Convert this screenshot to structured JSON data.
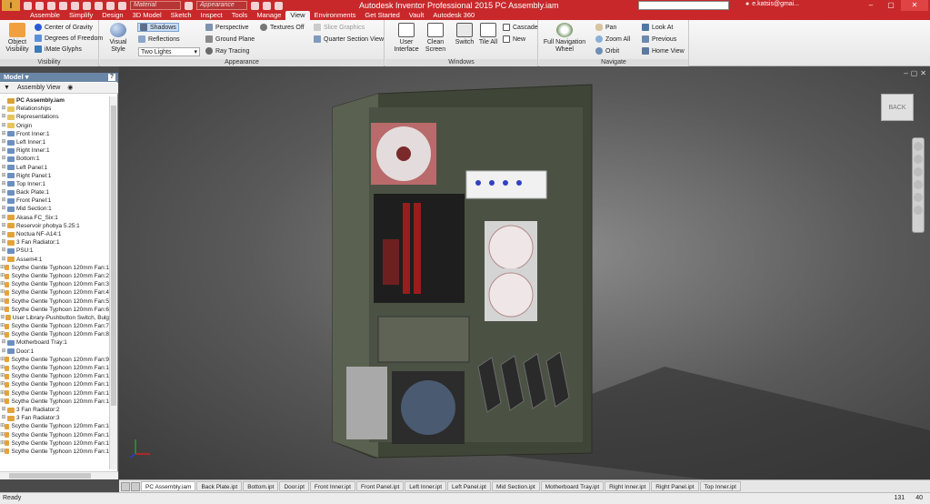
{
  "window": {
    "title": "Autodesk Inventor Professional 2015   PC Assembly.iam",
    "logo": "I",
    "material_combo": "Material",
    "appearance_combo": "Appearance",
    "user": "e.katsis@gmai...",
    "min": "–",
    "max": "▢",
    "close": "✕"
  },
  "ribbon_tabs": [
    "Assemble",
    "Simplify",
    "Design",
    "3D Model",
    "Sketch",
    "Inspect",
    "Tools",
    "Manage",
    "View",
    "Environments",
    "Get Started",
    "Vault",
    "Autodesk 360"
  ],
  "active_tab": "View",
  "ribbon": {
    "visibility": {
      "label": "Visibility",
      "object_visibility": "Object Visibility",
      "center_of_gravity": "Center of Gravity",
      "degrees_of_freedom": "Degrees of Freedom",
      "imate_glyphs": "iMate Glyphs"
    },
    "appearance": {
      "label": "Appearance",
      "visual_style": "Visual Style",
      "shadows": "Shadows",
      "reflections": "Reflections",
      "lighting": "Two Lights",
      "perspective": "Perspective",
      "ground_plane": "Ground Plane",
      "ray_tracing": "Ray Tracing",
      "textures": "Textures Off",
      "slice_graphics": "Slice Graphics",
      "quarter_section": "Quarter Section View"
    },
    "windows": {
      "label": "Windows",
      "user_interface": "User Interface",
      "clean_screen": "Clean Screen",
      "switch": "Switch",
      "tile_all": "Tile All",
      "cascade": "Cascade",
      "new": "New"
    },
    "navigate": {
      "label": "Navigate",
      "full_nav_wheel": "Full Navigation Wheel",
      "pan": "Pan",
      "zoom_all": "Zoom All",
      "orbit": "Orbit",
      "look_at": "Look At",
      "previous": "Previous",
      "home_view": "Home View"
    }
  },
  "browser": {
    "header": "Model ▾",
    "help": "?",
    "toolbar_view": "Assembly View",
    "items": [
      {
        "label": "PC Assembly.iam",
        "icon": "assembly-icon",
        "root": true
      },
      {
        "label": "Relationships",
        "icon": "folder-icon"
      },
      {
        "label": "Representations",
        "icon": "folder-icon"
      },
      {
        "label": "Origin",
        "icon": "folder-icon"
      },
      {
        "label": "Front Inner:1",
        "icon": "part-icon"
      },
      {
        "label": "Left Inner:1",
        "icon": "part-icon"
      },
      {
        "label": "Right Inner:1",
        "icon": "part-icon"
      },
      {
        "label": "Bottom:1",
        "icon": "part-icon"
      },
      {
        "label": "Left Panel:1",
        "icon": "part-icon"
      },
      {
        "label": "Right Panel:1",
        "icon": "part-icon"
      },
      {
        "label": "Top Inner:1",
        "icon": "part-icon"
      },
      {
        "label": "Back Plate:1",
        "icon": "part-icon"
      },
      {
        "label": "Front Panel:1",
        "icon": "part-icon"
      },
      {
        "label": "Mid Section:1",
        "icon": "part-icon"
      },
      {
        "label": "Akasa FC_Six:1",
        "icon": "subassembly-icon"
      },
      {
        "label": "Reservoir phobya 5.25:1",
        "icon": "subassembly-icon"
      },
      {
        "label": "Noctua NF-A14:1",
        "icon": "subassembly-icon"
      },
      {
        "label": "3 Fan Radiator:1",
        "icon": "subassembly-icon"
      },
      {
        "label": "PSU:1",
        "icon": "part-icon"
      },
      {
        "label": "Assem4:1",
        "icon": "subassembly-icon"
      },
      {
        "label": "Scythe Gentle Typhoon 120mm Fan:1",
        "icon": "subassembly-icon"
      },
      {
        "label": "Scythe Gentle Typhoon 120mm Fan:2",
        "icon": "subassembly-icon"
      },
      {
        "label": "Scythe Gentle Typhoon 120mm Fan:3",
        "icon": "subassembly-icon"
      },
      {
        "label": "Scythe Gentle Typhoon 120mm Fan:4",
        "icon": "subassembly-icon"
      },
      {
        "label": "Scythe Gentle Typhoon 120mm Fan:5",
        "icon": "subassembly-icon"
      },
      {
        "label": "Scythe Gentle Typhoon 120mm Fan:6",
        "icon": "subassembly-icon"
      },
      {
        "label": "User Library-Pushbutton Switch, Bulg",
        "icon": "subassembly-icon"
      },
      {
        "label": "Scythe Gentle Typhoon 120mm Fan:7",
        "icon": "subassembly-icon"
      },
      {
        "label": "Scythe Gentle Typhoon 120mm Fan:8",
        "icon": "subassembly-icon"
      },
      {
        "label": "Motherboard Tray:1",
        "icon": "part-icon"
      },
      {
        "label": "Door:1",
        "icon": "part-icon"
      },
      {
        "label": "Scythe Gentle Typhoon 120mm Fan:9",
        "icon": "subassembly-icon"
      },
      {
        "label": "Scythe Gentle Typhoon 120mm Fan:1",
        "icon": "subassembly-icon"
      },
      {
        "label": "Scythe Gentle Typhoon 120mm Fan:1",
        "icon": "subassembly-icon"
      },
      {
        "label": "Scythe Gentle Typhoon 120mm Fan:1",
        "icon": "subassembly-icon"
      },
      {
        "label": "Scythe Gentle Typhoon 120mm Fan:1",
        "icon": "subassembly-icon"
      },
      {
        "label": "Scythe Gentle Typhoon 120mm Fan:1",
        "icon": "subassembly-icon"
      },
      {
        "label": "3 Fan Radiator:2",
        "icon": "subassembly-icon"
      },
      {
        "label": "3 Fan Radiator:3",
        "icon": "subassembly-icon"
      },
      {
        "label": "Scythe Gentle Typhoon 120mm Fan:1",
        "icon": "subassembly-icon"
      },
      {
        "label": "Scythe Gentle Typhoon 120mm Fan:1",
        "icon": "subassembly-icon"
      },
      {
        "label": "Scythe Gentle Typhoon 120mm Fan:1",
        "icon": "subassembly-icon"
      },
      {
        "label": "Scythe Gentle Typhoon 120mm Fan:1",
        "icon": "subassembly-icon"
      }
    ]
  },
  "viewport": {
    "viewcube_label": "BACK"
  },
  "document_tabs": [
    "PC Assembly.iam",
    "Back Plate.ipt",
    "Bottom.ipt",
    "Door.ipt",
    "Front Inner.ipt",
    "Front Panel.ipt",
    "Left Inner.ipt",
    "Left Panel.ipt",
    "Mid Section.ipt",
    "Motherboard Tray.ipt",
    "Right Inner.ipt",
    "Right Panel.ipt",
    "Top Inner.ipt"
  ],
  "active_document": "PC Assembly.iam",
  "status": {
    "text": "Ready",
    "count1": "131",
    "count2": "40"
  },
  "colors": {
    "titlebar": "#c8282a",
    "case_body": "#4c5243",
    "fan_red": "#8a3a3a",
    "fan_white": "#e8e4e4"
  }
}
